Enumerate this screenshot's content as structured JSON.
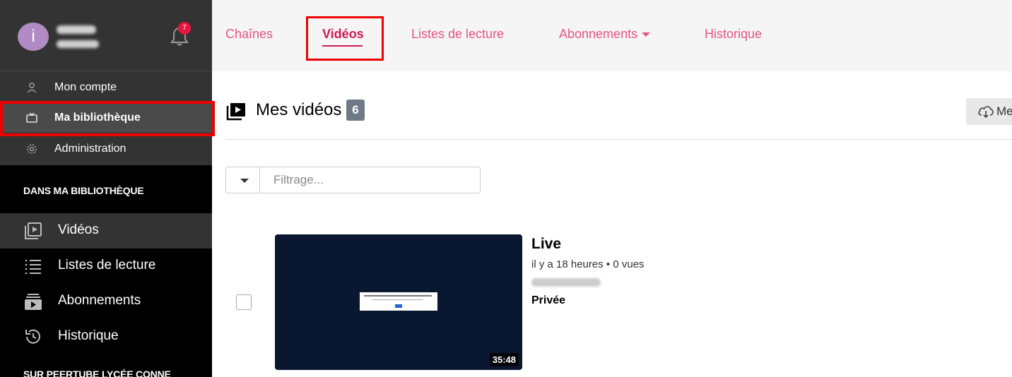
{
  "user": {
    "avatar_letter": "i",
    "notifications_count": "7"
  },
  "account_menu": [
    {
      "label": "Mon compte",
      "icon": "user-icon"
    },
    {
      "label": "Ma bibliothèque",
      "icon": "tv-icon"
    },
    {
      "label": "Administration",
      "icon": "gear-icon"
    }
  ],
  "sections": {
    "library_title": "DANS MA BIBLIOTHÈQUE",
    "instance_title": "SUR PEERTUBE LYCÉE CONNE"
  },
  "library_menu": [
    {
      "label": "Vidéos",
      "icon": "video-library-icon"
    },
    {
      "label": "Listes de lecture",
      "icon": "list-icon"
    },
    {
      "label": "Abonnements",
      "icon": "subscriptions-icon"
    },
    {
      "label": "Historique",
      "icon": "history-icon"
    }
  ],
  "tabs": [
    {
      "label": "Chaînes"
    },
    {
      "label": "Vidéos"
    },
    {
      "label": "Listes de lecture"
    },
    {
      "label": "Abonnements"
    },
    {
      "label": "Historique"
    }
  ],
  "main": {
    "title": "Mes vidéos",
    "count": "6",
    "download_label": "Me",
    "filter_placeholder": "Filtrage..."
  },
  "video": {
    "title": "Live",
    "meta": "il y a 18 heures • 0 vues",
    "privacy": "Privée",
    "duration": "35:48"
  },
  "colors": {
    "accent": "#d11a58",
    "tab_text": "#e55484",
    "sidebar_bg": "#000000",
    "highlight_box": "#ee0000"
  }
}
